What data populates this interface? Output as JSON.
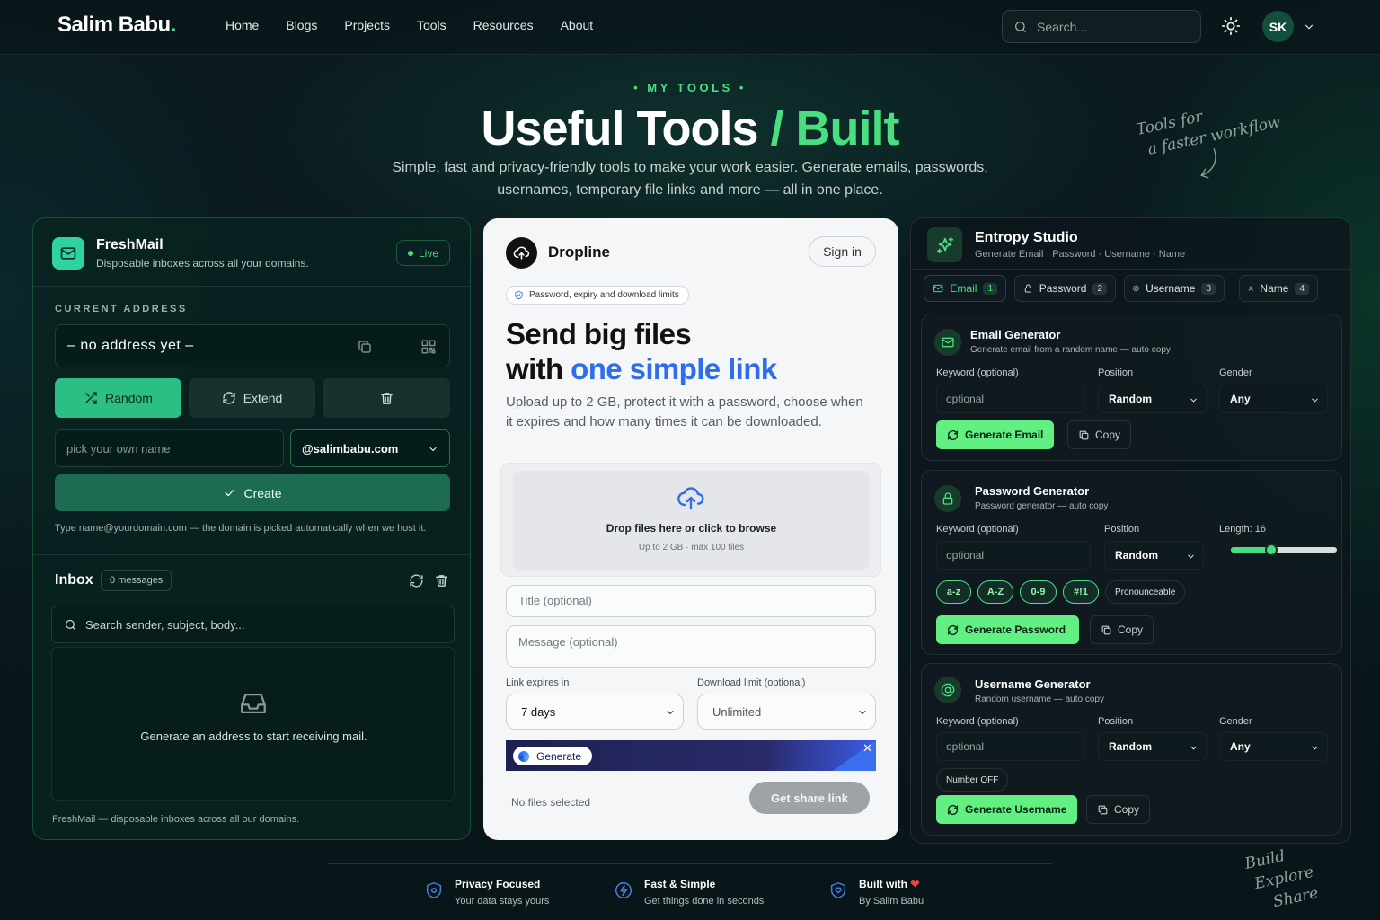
{
  "nav": {
    "logo": "Salim Babu",
    "logo_dot": ".",
    "links": [
      "Home",
      "Blogs",
      "Projects",
      "Tools",
      "Resources",
      "About"
    ],
    "search_placeholder": "Search...",
    "avatar": "SK"
  },
  "hero": {
    "eyebrow": "MY TOOLS",
    "title_a": "Useful Tools",
    "title_sep": "/",
    "title_b": "Built",
    "subtitle": "Simple, fast and privacy-friendly tools to make your work easier. Generate emails, passwords, usernames, temporary file links and more — all in one place.",
    "note_top": [
      "Tools for",
      "a faster workflow"
    ],
    "note_bottom": [
      "Build",
      "Explore",
      "Share"
    ]
  },
  "freshmail": {
    "title": "FreshMail",
    "subtitle": "Disposable inboxes across all your domains.",
    "status": "Live",
    "current_label": "CURRENT ADDRESS",
    "address": "– no address yet –",
    "random_label": "Random",
    "extend_label": "Extend",
    "name_placeholder": "pick your own name",
    "domain": "@salimbabu.com",
    "create_label": "Create",
    "hint": "Type name@yourdomain.com — the domain is picked automatically when we host it.",
    "inbox_title": "Inbox",
    "inbox_count": "0 messages",
    "inbox_search": "Search sender, subject, body...",
    "empty_text": "Generate an address to start receiving mail.",
    "footer": "FreshMail — disposable inboxes across all our domains."
  },
  "dropline": {
    "name": "Dropline",
    "signin": "Sign in",
    "pill": "Password, expiry and download limits",
    "heading_1": "Send big files",
    "heading_2a": "with ",
    "heading_2b": "one simple link",
    "description": "Upload up to 2 GB, protect it with a password, choose when it expires and how many times it can be downloaded.",
    "drop_title": "Drop files here or click to browse",
    "drop_sub": "Up to 2 GB · max 100 files",
    "title_placeholder": "Title (optional)",
    "message_placeholder": "Message (optional)",
    "expires_label": "Link expires in",
    "expires_value": "7 days",
    "limit_label": "Download limit (optional)",
    "limit_value": "Unlimited",
    "banner_button": "Generate",
    "no_files": "No files selected",
    "share_button": "Get share link"
  },
  "entropy": {
    "title": "Entropy Studio",
    "subtitle": "Generate Email · Password · Username · Name",
    "tabs": [
      {
        "label": "Email",
        "count": "1"
      },
      {
        "label": "Password",
        "count": "2"
      },
      {
        "label": "Username",
        "count": "3"
      },
      {
        "label": "Name",
        "count": "4"
      }
    ],
    "email": {
      "title": "Email Generator",
      "subtitle": "Generate email from a random name — auto copy",
      "keyword_label": "Keyword (optional)",
      "keyword_placeholder": "optional",
      "position_label": "Position",
      "position_value": "Random",
      "gender_label": "Gender",
      "gender_value": "Any",
      "generate": "Generate Email",
      "copy": "Copy"
    },
    "password": {
      "title": "Password Generator",
      "subtitle": "Password generator — auto copy",
      "keyword_label": "Keyword (optional)",
      "keyword_placeholder": "optional",
      "position_label": "Position",
      "position_value": "Random",
      "length_label": "Length: 16",
      "length_fraction": 0.38,
      "chips": [
        "a-z",
        "A-Z",
        "0-9",
        "#!1"
      ],
      "pronounceable": "Pronounceable",
      "generate": "Generate Password",
      "copy": "Copy"
    },
    "username": {
      "title": "Username Generator",
      "subtitle": "Random username — auto copy",
      "keyword_label": "Keyword (optional)",
      "keyword_placeholder": "optional",
      "position_label": "Position",
      "position_value": "Random",
      "gender_label": "Gender",
      "gender_value": "Any",
      "number_toggle": "Number OFF",
      "generate": "Generate Username",
      "copy": "Copy"
    }
  },
  "footer": {
    "features": [
      {
        "title": "Privacy Focused",
        "sub": "Your data stays yours",
        "icon": "shield-icon"
      },
      {
        "title": "Fast & Simple",
        "sub": "Get things done in seconds",
        "icon": "bolt-icon"
      },
      {
        "title": "Built with",
        "sub": "By Salim Babu",
        "icon": "heart-shield-icon"
      }
    ]
  },
  "colors": {
    "accent": "#4ade80",
    "link_blue": "#2f6ee8",
    "bg": "#0a1a1e"
  }
}
